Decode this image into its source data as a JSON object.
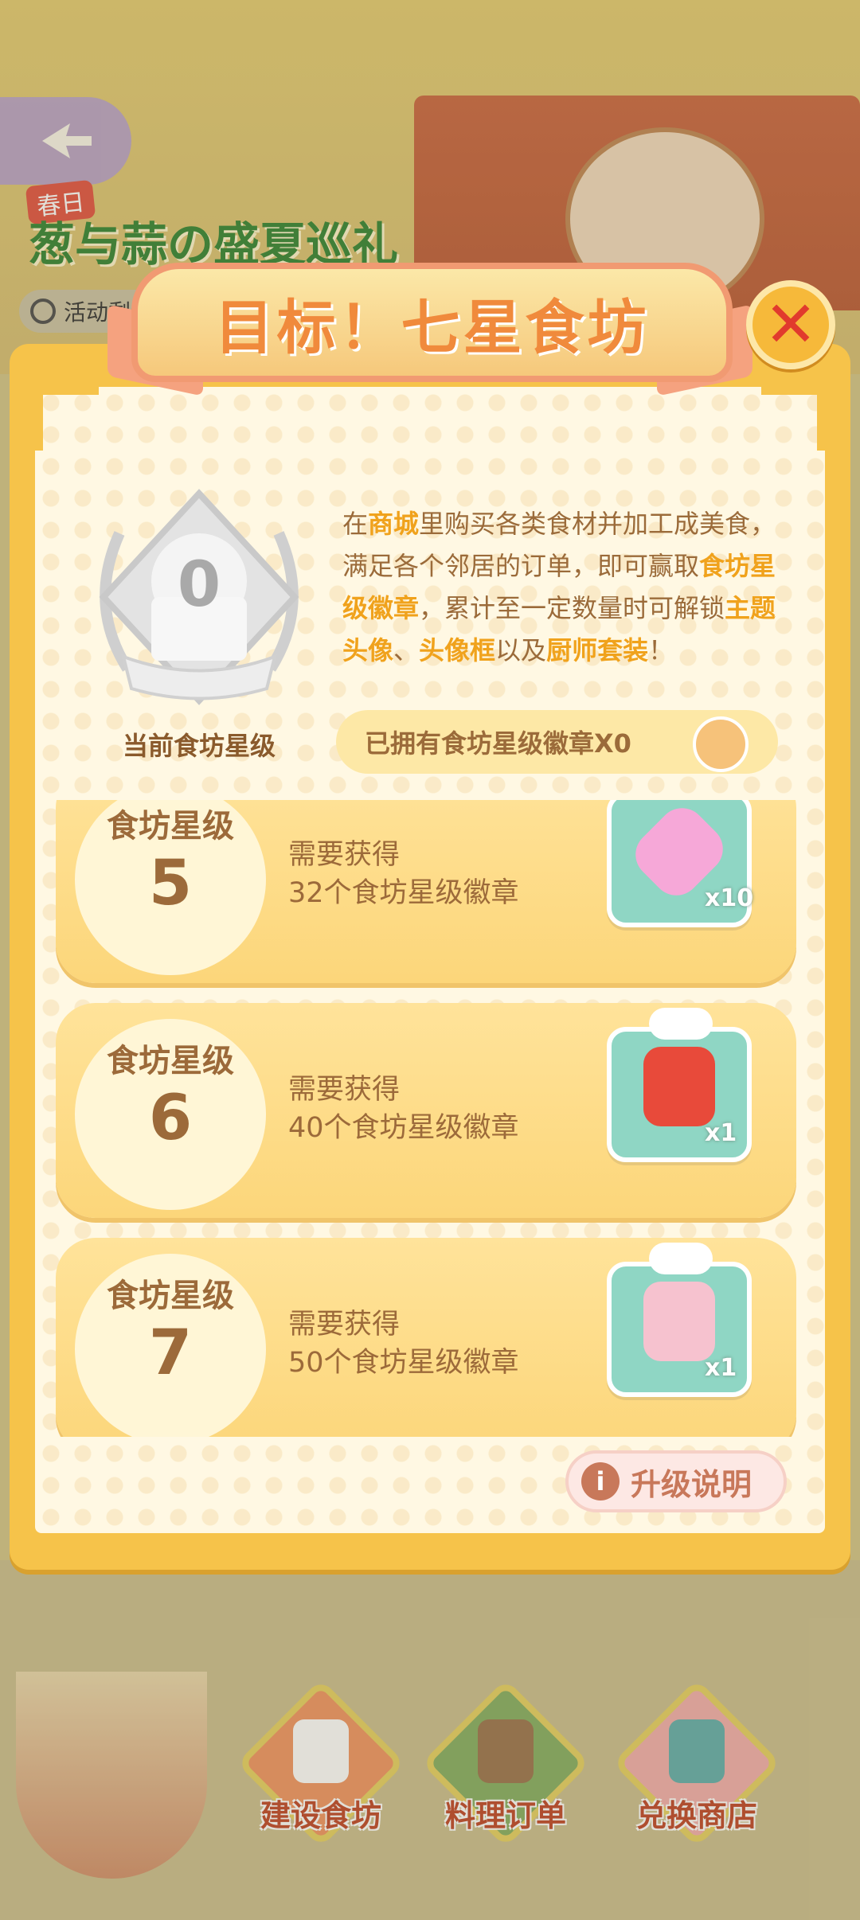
{
  "background": {
    "event_tag": "春日",
    "event_title": "葱与蒜の盛夏巡礼",
    "timer_label": "活动剩余"
  },
  "modal": {
    "title": "目标！七星食坊",
    "close_label": "✕",
    "badge": {
      "value": "0",
      "label": "当前食坊星级"
    },
    "description": {
      "p1": "在",
      "h1": "商城",
      "p2": "里购买各类食材并加工成美食，满足各个邻居的订单，即可赢取",
      "h2": "食坊星级徽章",
      "p3": "，累计至一定数量时可解锁",
      "h3": "主题头像",
      "p4": "、",
      "h4": "头像框",
      "p5": "以及",
      "h5": "厨师套装",
      "p6": "！"
    },
    "owned_text": "已拥有食坊星级徽章X0",
    "levels": [
      {
        "label": "食坊星级",
        "level": "5",
        "need": "需要获得",
        "requirement": "32个食坊星级徽章",
        "reward_icon": "rainbow-star-icon",
        "reward_count": "x10",
        "reward_color": "#f6a8d8"
      },
      {
        "label": "食坊星级",
        "level": "6",
        "need": "需要获得",
        "requirement": "40个食坊星级徽章",
        "reward_icon": "red-dress-icon",
        "reward_color": "#e84a3a",
        "reward_count": "x1"
      },
      {
        "label": "食坊星级",
        "level": "7",
        "need": "需要获得",
        "requirement": "50个食坊星级徽章",
        "reward_icon": "bunny-book-icon",
        "reward_color": "#f6c2cf",
        "reward_count": "x1"
      }
    ],
    "upgrade_button": "升级说明"
  },
  "bottom_nav": [
    {
      "label": "建设食坊",
      "icon": "chef-hat-icon",
      "color": "#f29a6a"
    },
    {
      "label": "料理订单",
      "icon": "order-clipboard-icon",
      "color": "#8bb36a"
    },
    {
      "label": "兑换商店",
      "icon": "shop-stall-icon",
      "color": "#f4b3b0"
    }
  ],
  "colors": {
    "frame": "#f6c34a",
    "highlight": "#f0a21c",
    "text_brown": "#9c6a3a",
    "close_red": "#e13a2d"
  }
}
